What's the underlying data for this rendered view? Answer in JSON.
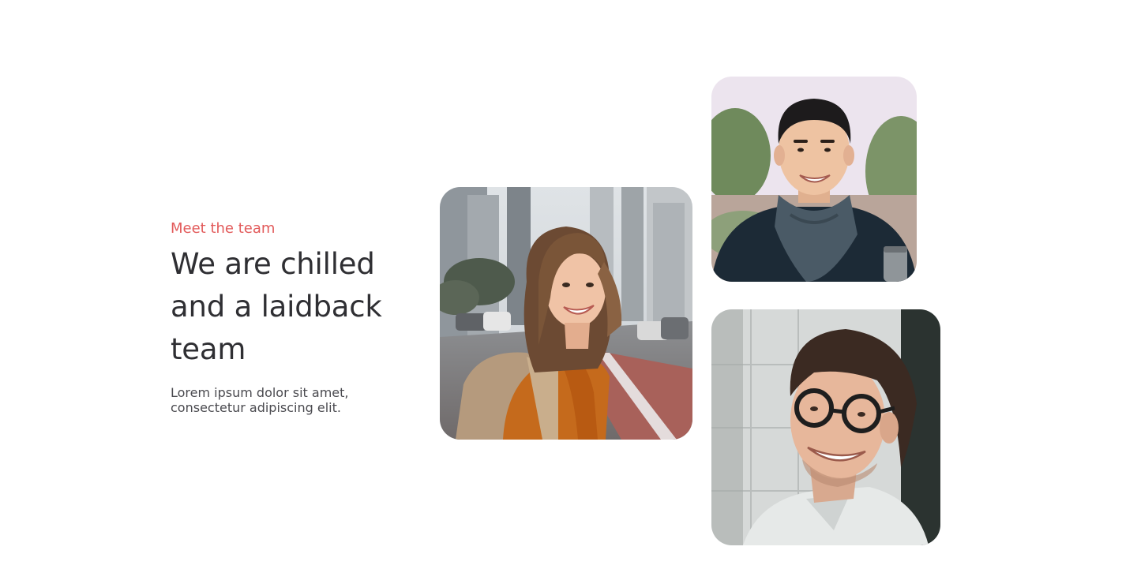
{
  "team_section": {
    "eyebrow": "Meet the team",
    "headline": "We are chilled and a laidback team",
    "description": "Lorem ipsum dolor sit amet, consectetur adipiscing elit."
  },
  "colors": {
    "accent": "#e25a5a",
    "heading": "#2f2f33",
    "body_text": "#4a4a4f",
    "background": "#ffffff"
  }
}
